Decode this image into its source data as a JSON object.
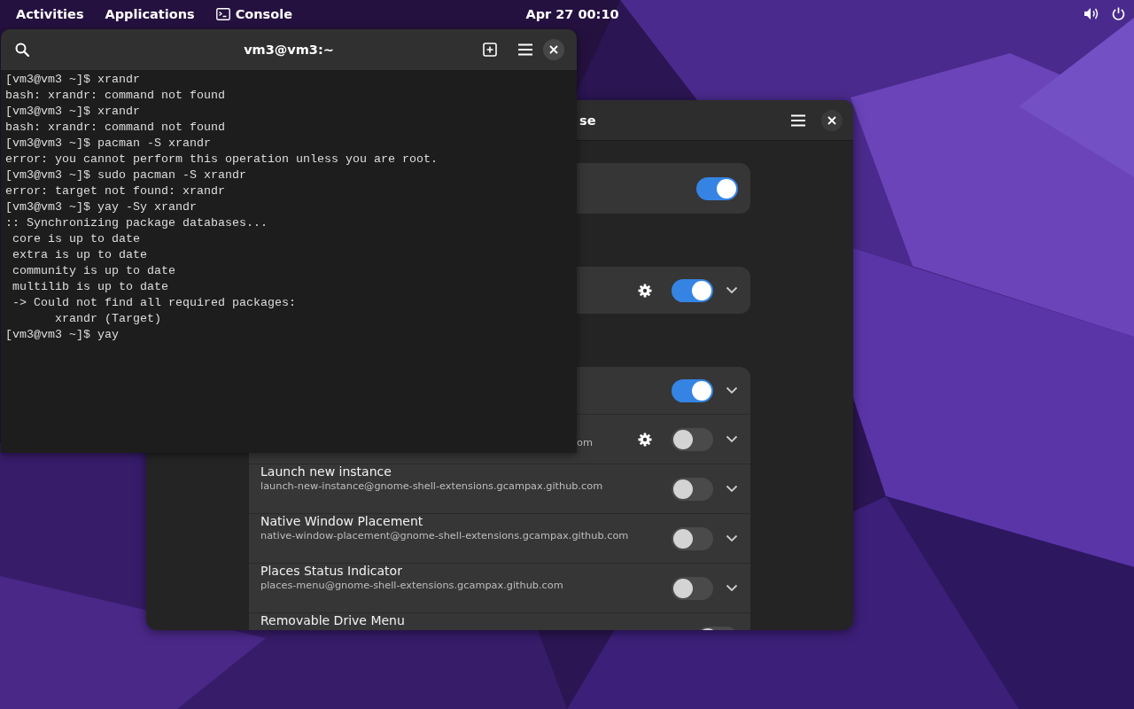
{
  "top_bar": {
    "activities": "Activities",
    "applications": "Applications",
    "app_name": "Console",
    "clock": "Apr 27  00:10"
  },
  "terminal": {
    "title": "vm3@vm3:~",
    "lines": [
      "[vm3@vm3 ~]$ xrandr",
      "bash: xrandr: command not found",
      "[vm3@vm3 ~]$ xrandr",
      "bash: xrandr: command not found",
      "[vm3@vm3 ~]$ pacman -S xrandr",
      "error: you cannot perform this operation unless you are root.",
      "[vm3@vm3 ~]$ sudo pacman -S xrandr",
      "error: target not found: xrandr",
      "[vm3@vm3 ~]$ yay -Sy xrandr",
      ":: Synchronizing package databases...",
      " core is up to date",
      " extra is up to date",
      " community is up to date",
      " multilib is up to date",
      " -> Could not find all required packages:",
      "       xrandr (Target)",
      "[vm3@vm3 ~]$ yay"
    ]
  },
  "extensions_window": {
    "title": "se",
    "cards": [
      {
        "rows": [
          {
            "on": true,
            "settings": false,
            "expander": false
          }
        ]
      },
      {
        "rows": [
          {
            "on": true,
            "settings": true,
            "expander": true
          }
        ]
      },
      {
        "rows": [
          {
            "on": true,
            "settings": false,
            "expander": true
          },
          {
            "subtitle": "om",
            "on": false,
            "settings": true,
            "expander": true
          },
          {
            "title": "Launch new instance",
            "subtitle": "launch-new-instance@gnome-shell-extensions.gcampax.github.com",
            "on": false,
            "settings": false,
            "expander": true
          },
          {
            "title": "Native Window Placement",
            "subtitle": "native-window-placement@gnome-shell-extensions.gcampax.github.com",
            "on": false,
            "settings": false,
            "expander": true
          },
          {
            "title": "Places Status Indicator",
            "subtitle": "places-menu@gnome-shell-extensions.gcampax.github.com",
            "on": false,
            "settings": false,
            "expander": true
          },
          {
            "title": "Removable Drive Menu",
            "on": false,
            "settings": false,
            "expander": false
          }
        ]
      }
    ]
  }
}
